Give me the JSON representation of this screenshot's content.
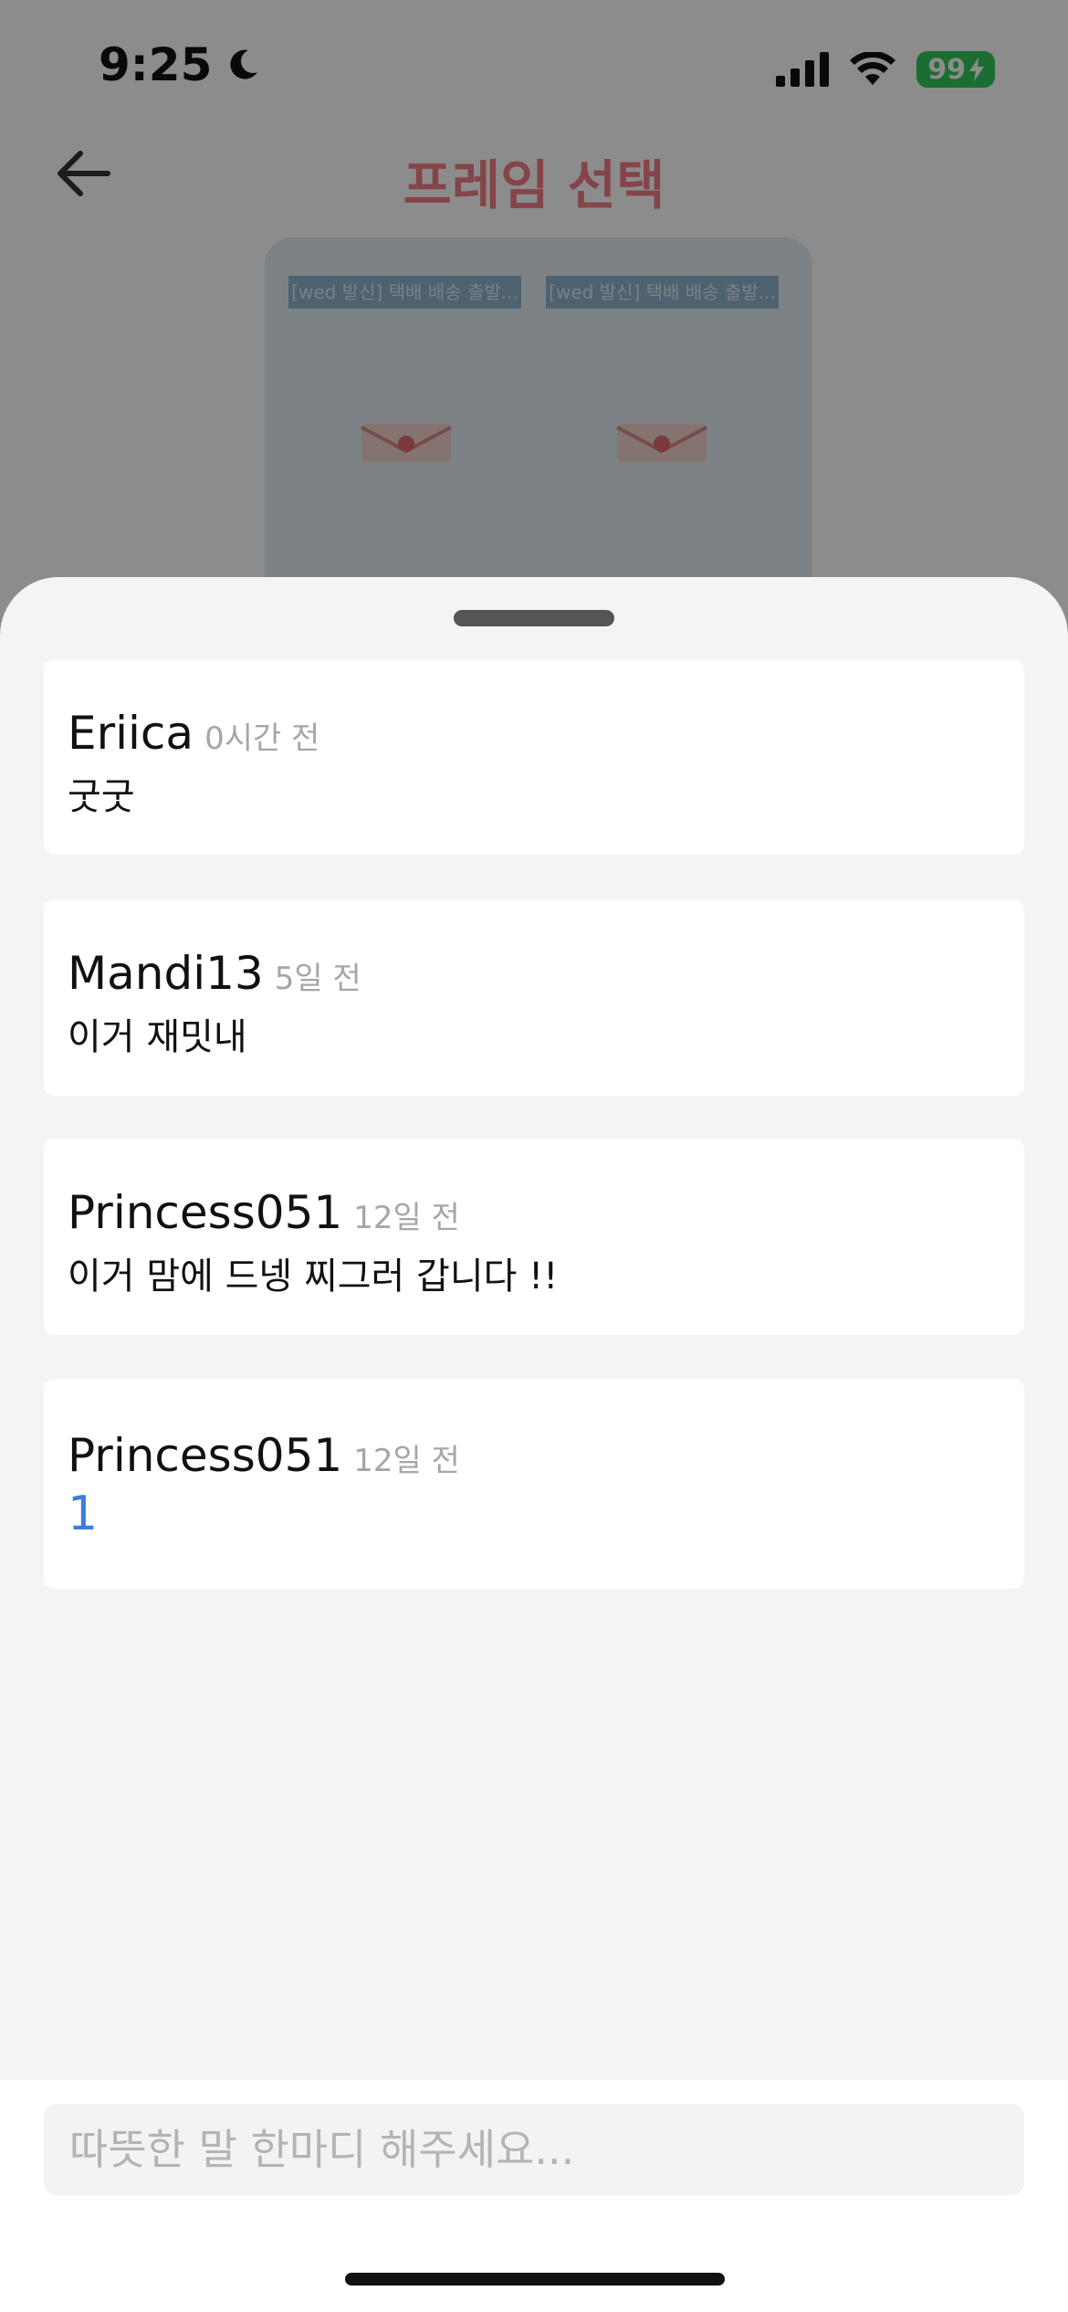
{
  "status_bar": {
    "time": "9:25",
    "battery": "99"
  },
  "header": {
    "title": "프레임 선택"
  },
  "frames": [
    {
      "label": "[wed 발신] 택배 배송 출발..."
    },
    {
      "label": "[wed 발신] 택배 배송 출발..."
    }
  ],
  "comments": [
    {
      "author": "Eriica",
      "time": "0시간 전",
      "text": "굿굿"
    },
    {
      "author": "Mandi13",
      "time": "5일 전",
      "text": "이거 재밋내"
    },
    {
      "author": "Princess051",
      "time": "12일 전",
      "text": "이거 맘에 드넹 찌그러 갑니다 !!"
    },
    {
      "author": "Princess051",
      "time": "12일 전",
      "text": "1"
    }
  ],
  "input": {
    "placeholder": "따뜻한 말 한마디 해주세요..."
  },
  "colors": {
    "title": "#f07c86",
    "link_text": "#3b7ddd",
    "battery": "#34c759"
  }
}
